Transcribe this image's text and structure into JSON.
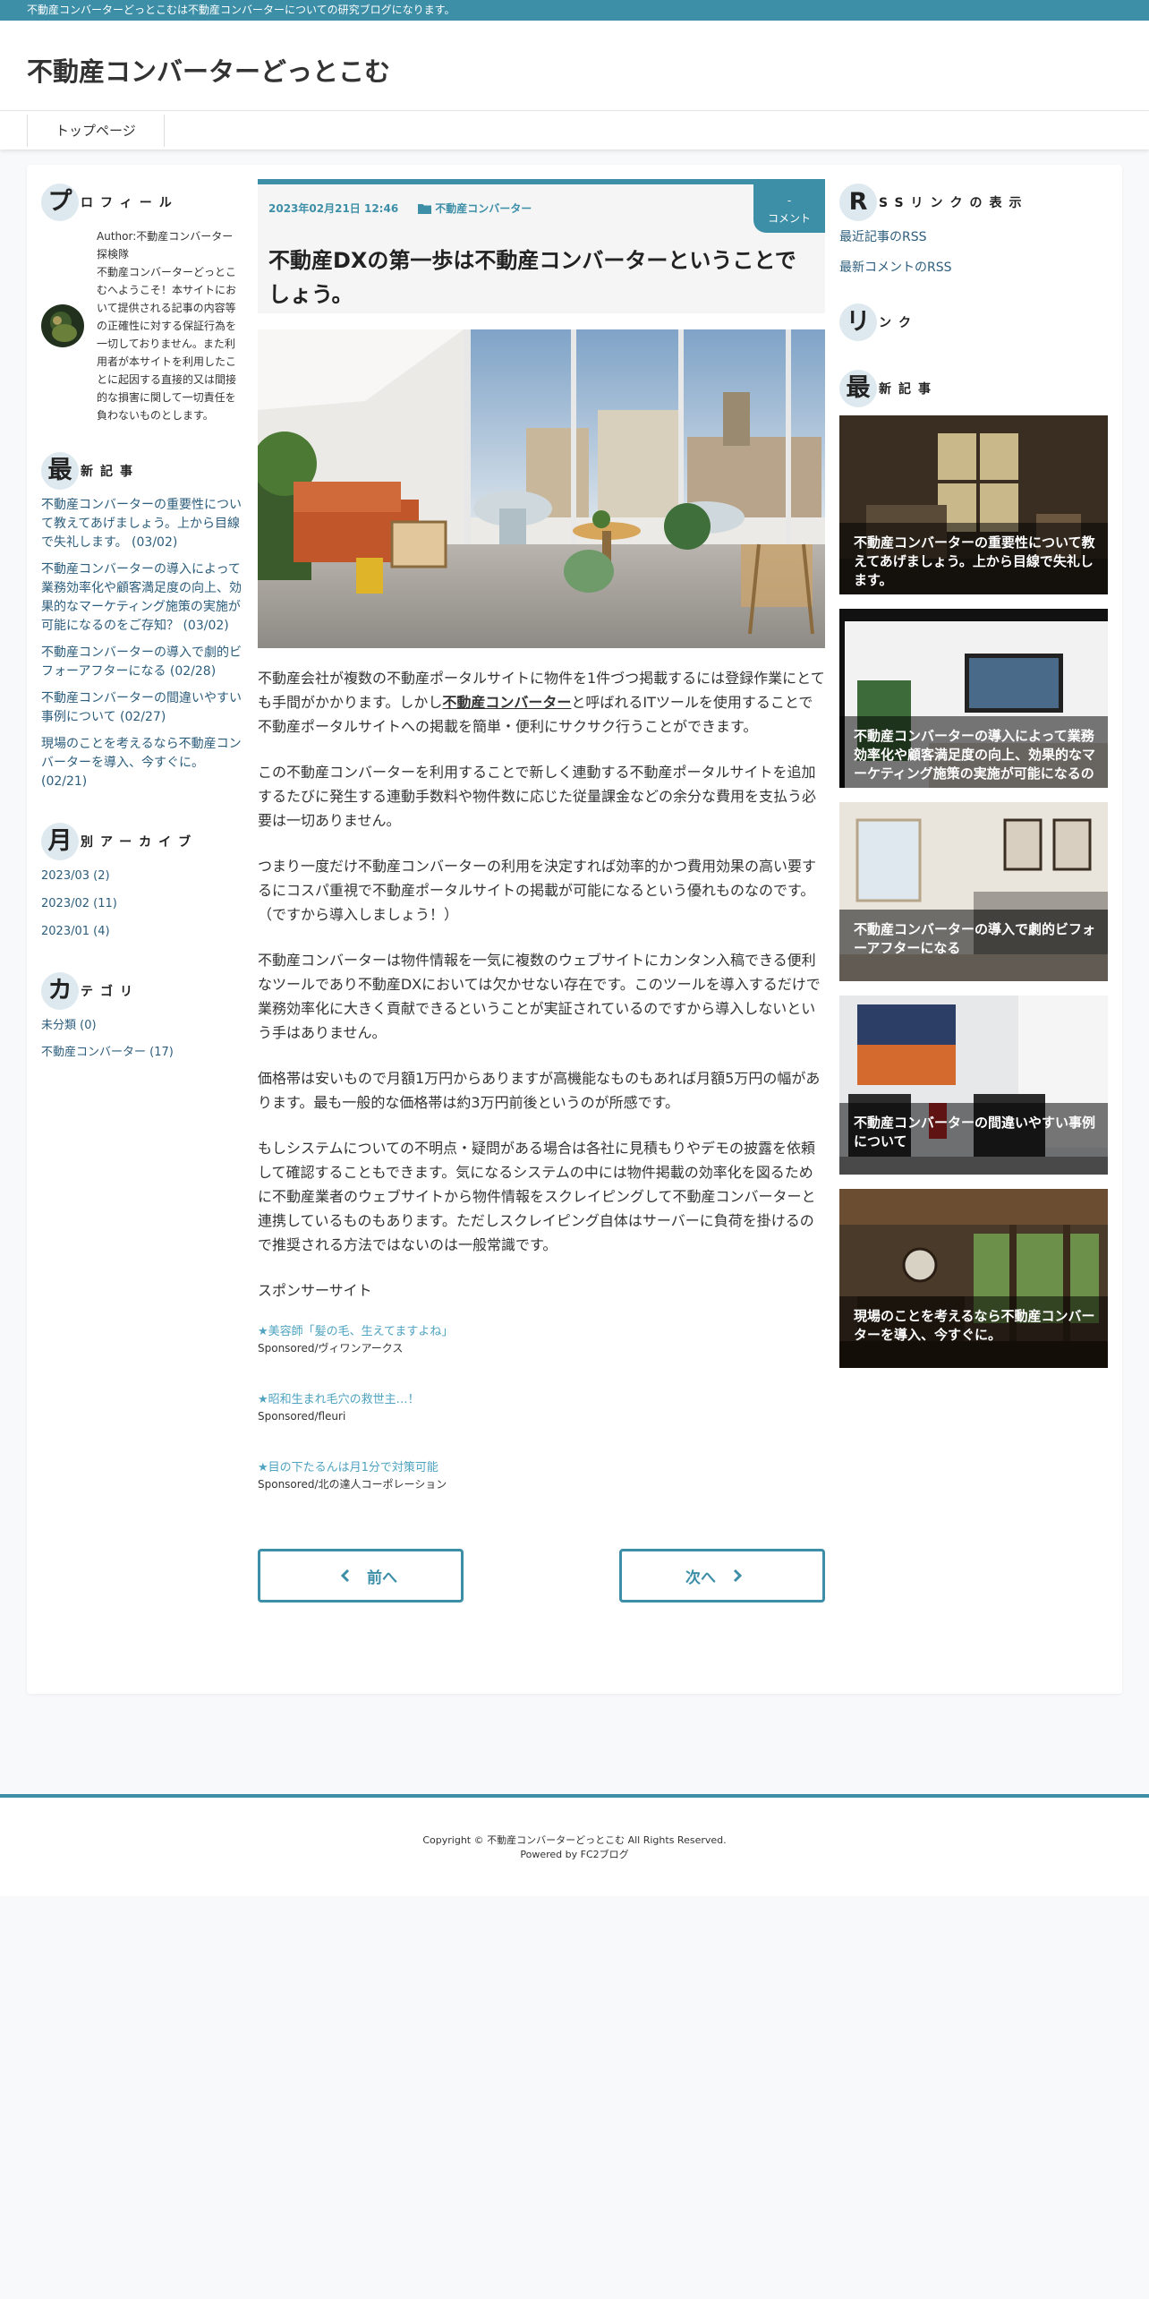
{
  "topbar": {
    "text": "不動産コンバーターどっとこむは不動産コンバーターについての研究ブログになります。"
  },
  "site": {
    "title": "不動産コンバーターどっとこむ"
  },
  "nav": {
    "items": [
      {
        "label": "トップページ"
      }
    ]
  },
  "profile": {
    "cap": "プ",
    "rest": "ロフィール",
    "author": "Author:不動産コンバーター探検隊",
    "text": "不動産コンバーターどっとこむへようこそ！本サイトにおいて提供される記事の内容等の正確性に対する保証行為を一切しておりません。また利用者が本サイトを利用したことに起因する直接的又は間接的な損害に関して一切責任を負わないものとします。"
  },
  "recent_left": {
    "cap": "最",
    "rest": "新記事",
    "items": [
      {
        "label": "不動産コンバーターの重要性について教えてあげましょう。上から目線で失礼します。 (03/02)"
      },
      {
        "label": "不動産コンバーターの導入によって業務効率化や顧客満足度の向上、効果的なマーケティング施策の実施が可能になるのをご存知？ (03/02)"
      },
      {
        "label": "不動産コンバーターの導入で劇的ビフォーアフターになる (02/28)"
      },
      {
        "label": "不動産コンバーターの間違いやすい事例について (02/27)"
      },
      {
        "label": "現場のことを考えるなら不動産コンバーターを導入、今すぐに。 (02/21)"
      }
    ]
  },
  "archive": {
    "cap": "月",
    "rest": "別アーカイブ",
    "items": [
      {
        "label": "2023/03 (2)"
      },
      {
        "label": "2023/02 (11)"
      },
      {
        "label": "2023/01 (4)"
      }
    ]
  },
  "category": {
    "cap": "カ",
    "rest": "テゴリ",
    "items": [
      {
        "label": "未分類 (0)"
      },
      {
        "label": "不動産コンバーター (17)"
      }
    ]
  },
  "entry": {
    "date": "2023年02月21日 12:46",
    "category": "不動産コンバーター",
    "comment_count": "-",
    "comment_label": "コメント",
    "title": "不動産DXの第一歩は不動産コンバーターということでしょう。",
    "p1_before": "不動産会社が複数の不動産ポータルサイトに物件を1件づつ掲載するには登録作業にとても手間がかかります。しかし",
    "p1_link": "不動産コンバーター",
    "p1_after": "と呼ばれるITツールを使用することで不動産ポータルサイトへの掲載を簡単・便利にサクサク行うことができます。",
    "p2": "この不動産コンバーターを利用することで新しく連動する不動産ポータルサイトを追加するたびに発生する連動手数料や物件数に応じた従量課金などの余分な費用を支払う必要は一切ありません。",
    "p3": "つまり一度だけ不動産コンバーターの利用を決定すれば効率的かつ費用効果の高い要するにコスパ重視で不動産ポータルサイトの掲載が可能になるという優れものなのです。（ですから導入しましょう！）",
    "p4": "不動産コンバーターは物件情報を一気に複数のウェブサイトにカンタン入稿できる便利なツールであり不動産DXにおいては欠かせない存在です。このツールを導入するだけで業務効率化に大きく貢献できるということが実証されているのですから導入しないという手はありません。",
    "p5": "価格帯は安いもので月額1万円からありますが高機能なものもあれば月額5万円の幅があります。最も一般的な価格帯は約3万円前後というのが所感です。",
    "p6": "もしシステムについての不明点・疑問がある場合は各社に見積もりやデモの披露を依頼して確認することもできます。気になるシステムの中には物件掲載の効率化を図るために不動産業者のウェブサイトから物件情報をスクレイピングして不動産コンバーターと連携しているものもあります。ただしスクレイピング自体はサーバーに負荷を掛けるので推奨される方法ではないのは一般常識です。",
    "sponsor_heading": "スポンサーサイト",
    "sponsors": [
      {
        "link": "★美容師「髪の毛、生えてますよね」",
        "by": "Sponsored/ヴィワンアークス"
      },
      {
        "link": "★昭和生まれ毛穴の救世主…！",
        "by": "Sponsored/fleuri"
      },
      {
        "link": "★目の下たるんは月1分で対策可能",
        "by": "Sponsored/北の達人コーポレーション"
      }
    ]
  },
  "pager": {
    "prev": "前へ",
    "next": "次へ"
  },
  "rss": {
    "cap": "R",
    "rest": "SSリンクの表示",
    "items": [
      {
        "label": "最近記事のRSS"
      },
      {
        "label": "最新コメントのRSS"
      }
    ]
  },
  "links": {
    "cap": "リ",
    "rest": "ンク"
  },
  "recent_right": {
    "cap": "最",
    "rest": "新記事",
    "cards": [
      {
        "title": "不動産コンバーターの重要性について教えてあげましょう。上から目線で失礼します。"
      },
      {
        "title": "不動産コンバーターの導入によって業務効率化や顧客満足度の向上、効果的なマーケティング施策の実施が可能になるの"
      },
      {
        "title": "不動産コンバーターの導入で劇的ビフォーアフターになる"
      },
      {
        "title": "不動産コンバーターの間違いやすい事例について"
      },
      {
        "title": "現場のことを考えるなら不動産コンバーターを導入、今すぐに。"
      }
    ]
  },
  "footer": {
    "copyright": "Copyright © 不動産コンバーターどっとこむ All Rights Reserved.",
    "powered": "Powered by FC2ブログ"
  },
  "colors": {
    "accent": "#3d8fa8",
    "link": "#2c5d7c",
    "sponsor": "#4fa3c0"
  }
}
